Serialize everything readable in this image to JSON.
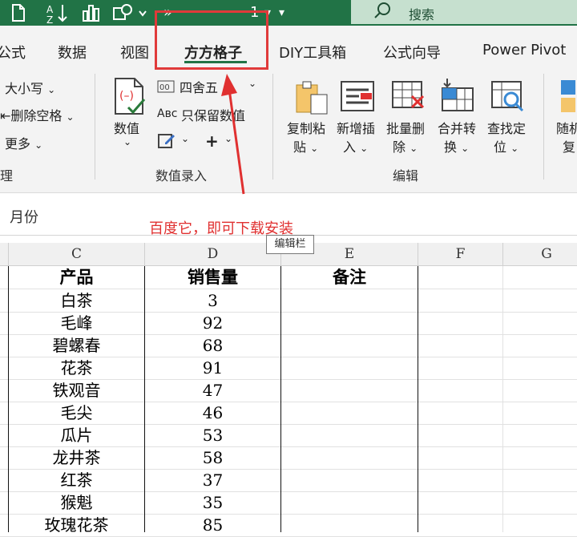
{
  "titlebar": {
    "search_label": "搜索",
    "counter": "1",
    "icons": [
      "file-icon",
      "sort-az-icon",
      "chart-icon",
      "shapes-icon"
    ]
  },
  "tabs": [
    "公式",
    "数据",
    "视图",
    "方方格子",
    "DIY工具箱",
    "公式向导",
    "Power Pivot"
  ],
  "active_tab": "方方格子",
  "ribbon": {
    "left_group": {
      "items": [
        "大小写",
        "删除空格",
        "更多"
      ],
      "label_partial": "理"
    },
    "numeric_group": {
      "big_button": "数值",
      "small_items": [
        "四舍五",
        "只保留数值"
      ],
      "label": "数值录入"
    },
    "edit_group": {
      "buttons": [
        "复制粘贴",
        "新增插入",
        "批量删除",
        "合并转换",
        "查找定位"
      ],
      "button_lines": [
        [
          "复制粘",
          "贴"
        ],
        [
          "新增插",
          "入"
        ],
        [
          "批量删",
          "除"
        ],
        [
          "合并转",
          "换"
        ],
        [
          "查找定",
          "位"
        ]
      ],
      "label": "编辑"
    },
    "right_partial": [
      "随机",
      "复"
    ]
  },
  "formula_bar": {
    "value": "月份"
  },
  "annotation": "百度它，即可下载安装",
  "tooltip": "编辑栏",
  "columns": [
    "C",
    "D",
    "E",
    "F",
    "G"
  ],
  "table": {
    "headers": [
      "产品",
      "销售量",
      "备注"
    ],
    "rows": [
      [
        "白茶",
        "3",
        ""
      ],
      [
        "毛峰",
        "92",
        ""
      ],
      [
        "碧螺春",
        "68",
        ""
      ],
      [
        "花茶",
        "91",
        ""
      ],
      [
        "铁观音",
        "47",
        ""
      ],
      [
        "毛尖",
        "46",
        ""
      ],
      [
        "瓜片",
        "53",
        ""
      ],
      [
        "龙井茶",
        "58",
        ""
      ],
      [
        "红茶",
        "37",
        ""
      ],
      [
        "猴魁",
        "35",
        ""
      ],
      [
        "玫瑰花茶",
        "85",
        ""
      ]
    ]
  },
  "colors": {
    "excel_green": "#217346",
    "highlight_red": "#e03a3a",
    "search_bg": "#c6e0cf"
  }
}
